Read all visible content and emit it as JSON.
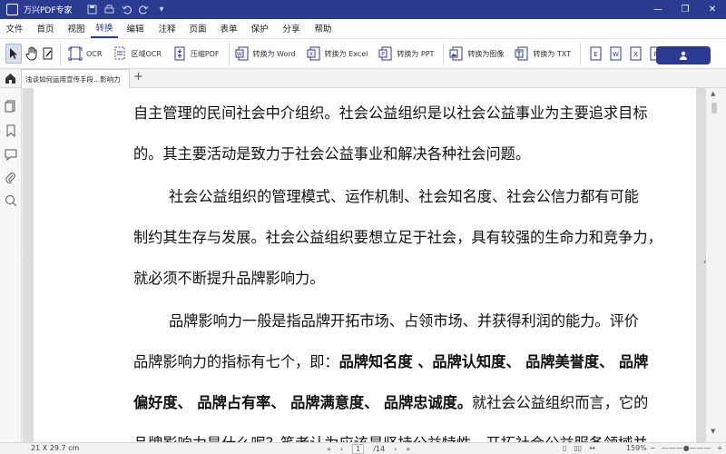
{
  "titlebar": {
    "title": "万兴PDF专家",
    "quick_access": [
      "save-icon",
      "print-icon",
      "undo-icon",
      "redo-icon",
      "dropdown-icon"
    ],
    "window_controls": [
      "minimize-icon",
      "restore-icon",
      "close-icon"
    ],
    "colors": {
      "bg": "#2b3b8f"
    }
  },
  "menubar": {
    "items": [
      {
        "label": "文件"
      },
      {
        "label": "首页"
      },
      {
        "label": "视图"
      },
      {
        "label": "转换",
        "active": true
      },
      {
        "label": "编辑"
      },
      {
        "label": "注释"
      },
      {
        "label": "页面"
      },
      {
        "label": "表单"
      },
      {
        "label": "保护"
      },
      {
        "label": "分享"
      },
      {
        "label": "帮助"
      }
    ]
  },
  "ribbon": {
    "tools": [
      {
        "name": "ocr",
        "label": "OCR"
      },
      {
        "name": "area-ocr",
        "label": "区域OCR"
      },
      {
        "name": "compress-pdf",
        "label": "压缩PDF"
      },
      {
        "name": "to-word",
        "label": "转换为 Word"
      },
      {
        "name": "to-excel",
        "label": "转换为 Excel"
      },
      {
        "name": "to-ppt",
        "label": "转换为 PPT"
      },
      {
        "name": "to-image",
        "label": "转换为图像"
      },
      {
        "name": "to-txt",
        "label": "转换为 TXT"
      }
    ],
    "extra_format_icons": [
      "E",
      "W",
      "X",
      "P"
    ]
  },
  "tabs": {
    "doc_tab": "浅谈如何运用宣传手段...影响力",
    "add": "+"
  },
  "document": {
    "lines": [
      {
        "text": "自主管理的民间社会中介组织。社会公益组织是以社会公益事业为主要追求目标"
      },
      {
        "text": "的。其主要活动是致力于社会公益事业和解决各种社会问题。"
      },
      {
        "text": "社会公益组织的管理模式、运作机制、社会知名度、社会公信力都有可能",
        "indent": true
      },
      {
        "text": "制约其生存与发展。社会公益组织要想立足于社会，具有较强的生命力和竞争力，"
      },
      {
        "text": "就必须不断提升品牌影响力。"
      },
      {
        "text": "品牌影响力一般是指品牌开拓市场、占领市场、并获得利润的能力。评价",
        "indent": true
      },
      {
        "pre": "品牌影响力的指标有七个，即：",
        "bold": "品牌知名度 、品牌认知度、 品牌美誉度、 品牌"
      },
      {
        "bold": "偏好度、 品牌占有率、 品牌满意度、 品牌忠诚度。",
        "post": "就社会公益组织而言，它的"
      },
      {
        "text": "品牌影响力是什么呢？笔者认为应该是坚持公益特性、开拓社会公益服务领域并"
      }
    ]
  },
  "statusbar": {
    "page_size": "21 X 29.7 cm",
    "page_current": "1",
    "page_total": "/14",
    "zoom": "159%"
  }
}
